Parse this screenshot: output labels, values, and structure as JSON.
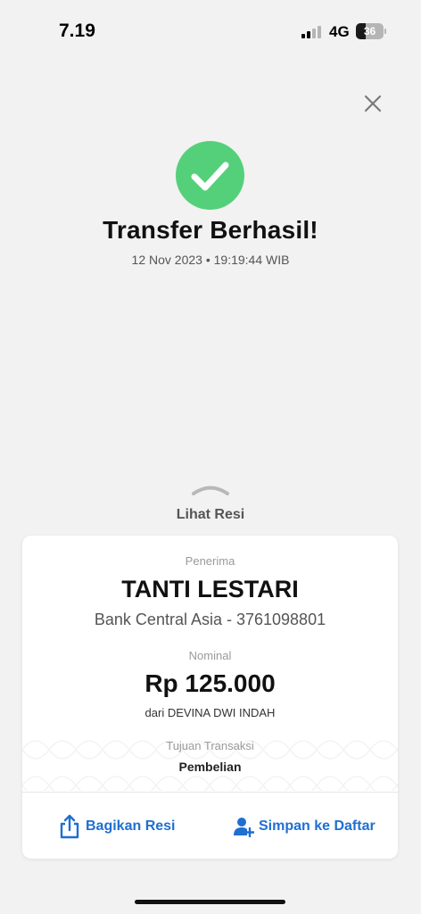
{
  "status_bar": {
    "time": "7.19",
    "network": "4G",
    "battery_level": "36",
    "signal_bars_active": 2,
    "signal_bars_total": 4
  },
  "success": {
    "title": "Transfer Berhasil!",
    "datetime": "12 Nov 2023 • 19:19:44 WIB"
  },
  "receipt_toggle": {
    "label": "Lihat Resi"
  },
  "receipt": {
    "recipient_label": "Penerima",
    "recipient_name": "TANTI LESTARI",
    "recipient_bank": "Bank Central Asia - 3761098801",
    "amount_label": "Nominal",
    "amount": "Rp 125.000",
    "from": "dari DEVINA DWI INDAH",
    "purpose_label": "Tujuan Transaksi",
    "purpose": "Pembelian"
  },
  "actions": {
    "share_label": "Bagikan Resi",
    "save_label": "Simpan ke Daftar"
  },
  "colors": {
    "success_green": "#55d07a",
    "action_blue": "#1f6fd0",
    "background": "#f2f2f2"
  },
  "icons": {
    "close": "close-icon",
    "check": "checkmark-icon",
    "chevron": "chevron-up-icon",
    "share": "share-icon",
    "save": "add-contact-icon"
  }
}
